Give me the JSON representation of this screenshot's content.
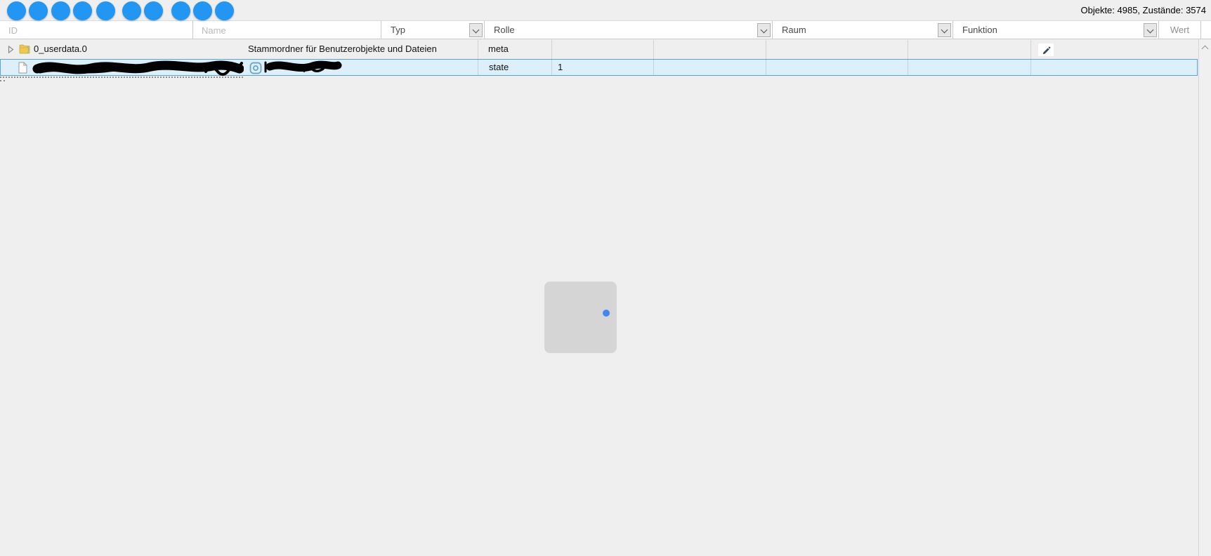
{
  "status": {
    "text": "Objekte: 4985, Zustände: 3574"
  },
  "toolbar": {
    "buttons": [
      "toolbar-button-1",
      "toolbar-button-2",
      "toolbar-button-3",
      "toolbar-button-4",
      "toolbar-button-5",
      "toolbar-button-6",
      "toolbar-button-7",
      "toolbar-button-8",
      "toolbar-button-9",
      "toolbar-button-10"
    ]
  },
  "filters": {
    "id_placeholder": "ID",
    "name_placeholder": "Name",
    "typ": "Typ",
    "rolle": "Rolle",
    "raum": "Raum",
    "funktion": "Funktion",
    "wert": "Wert"
  },
  "table": {
    "rows": [
      {
        "id": "0_userdata.0",
        "name": "Stammordner für Benutzerobjekte und Dateien",
        "type": "meta",
        "value": "",
        "icon": "folder-icon",
        "expandable": true,
        "selected": false,
        "redacted": false
      },
      {
        "id": "",
        "name": "",
        "type": "state",
        "value": "1",
        "icon": "file-icon",
        "expandable": false,
        "selected": true,
        "redacted": true
      }
    ]
  },
  "colors": {
    "accent_blue": "#2196f3",
    "selection_border": "#56a5d8",
    "selection_bg": "#dceffa",
    "dot_blue": "#4285f4",
    "square_gray": "#d5d5d5",
    "page_bg": "#efefef"
  }
}
